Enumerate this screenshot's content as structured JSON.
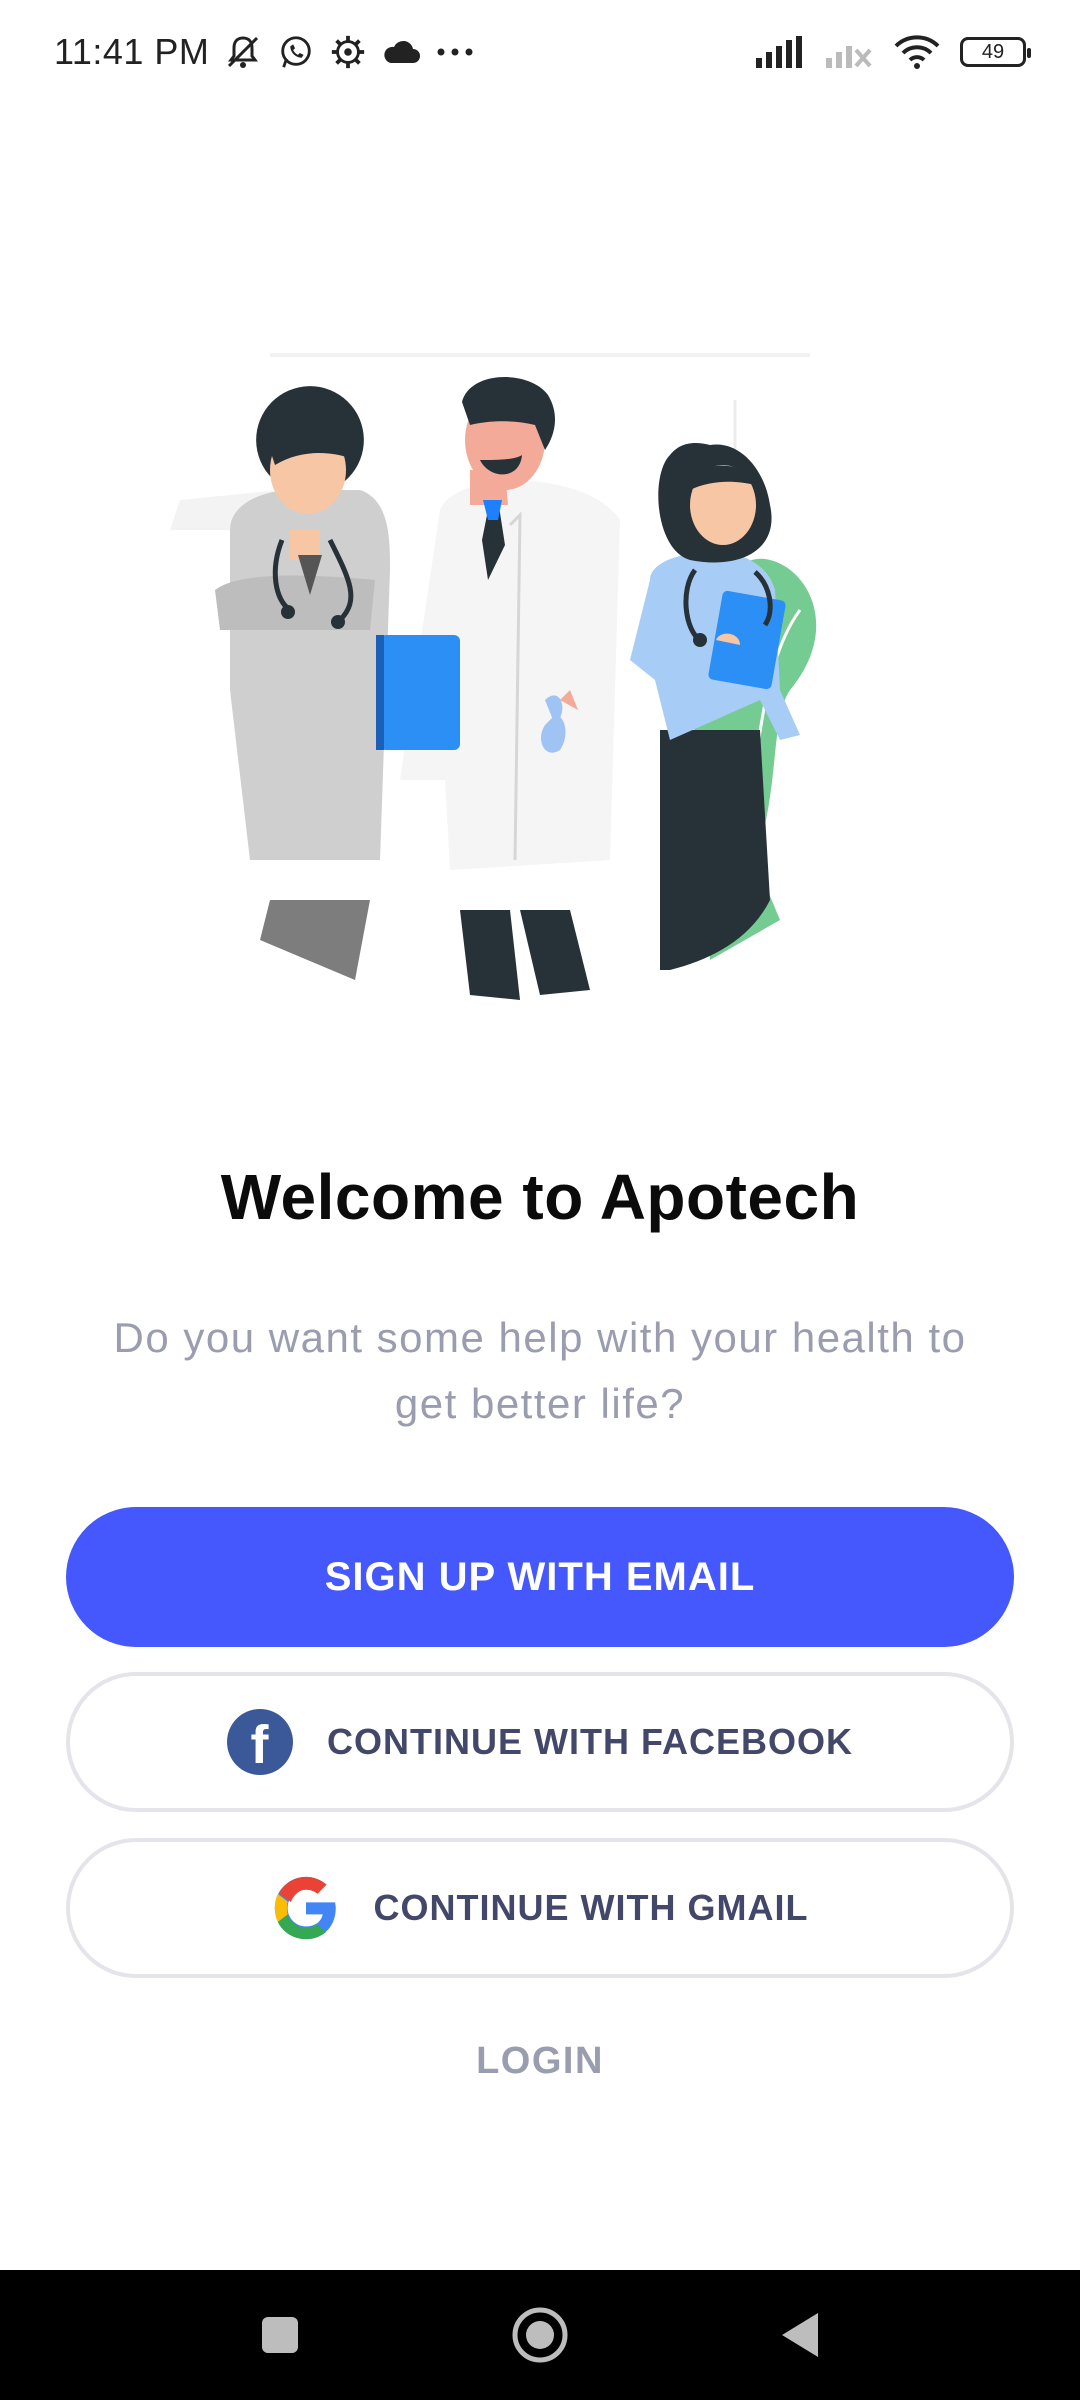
{
  "status_bar": {
    "time": "11:41 PM",
    "battery": "49",
    "icons": [
      "muted-icon",
      "whatsapp-icon",
      "settings-gear-icon",
      "cloud-icon",
      "more-dots-icon",
      "signal-icon",
      "signal-no-sim-icon",
      "wifi-icon",
      "battery-icon"
    ]
  },
  "welcome": {
    "title": "Welcome to Apotech",
    "subtitle": "Do you want some help with your health to get better life?"
  },
  "actions": {
    "signup_email": "SIGN UP WITH EMAIL",
    "continue_facebook": "CONTINUE WITH FACEBOOK",
    "continue_gmail": "CONTINUE WITH GMAIL",
    "login": "LOGIN"
  },
  "colors": {
    "primary": "#4558fd",
    "facebook": "#3b5998",
    "muted_text": "#9a9cb0",
    "outline_text": "#434769"
  }
}
